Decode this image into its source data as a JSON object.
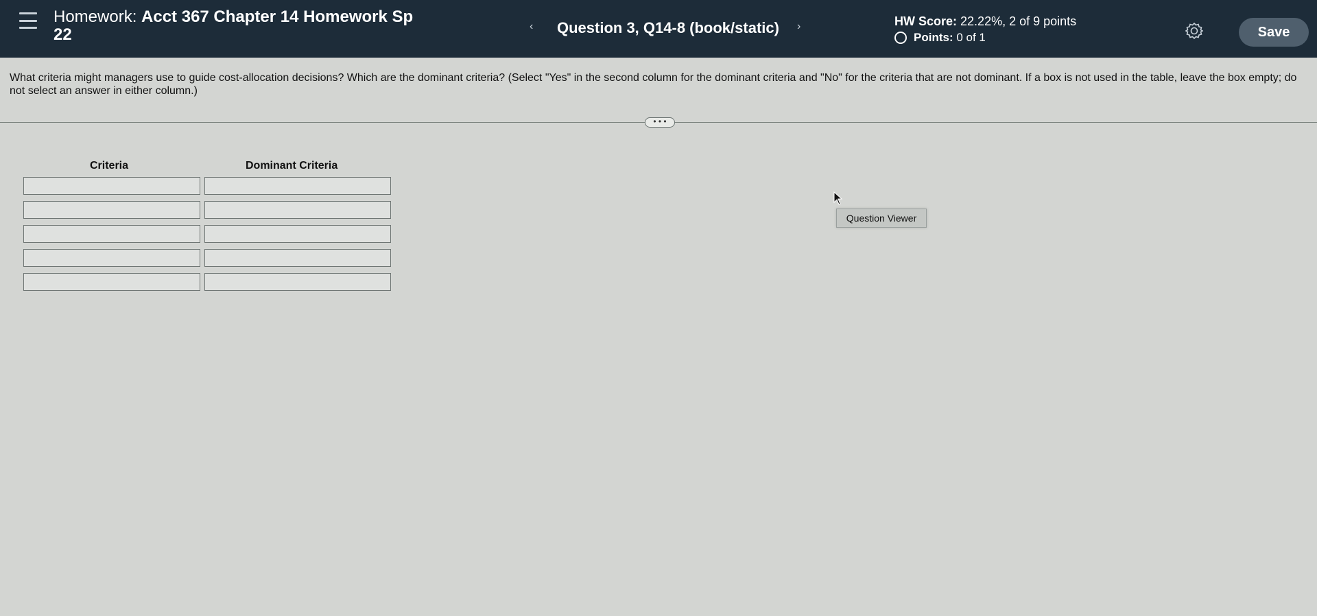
{
  "header": {
    "hw_label": "Homework:",
    "hw_name": "Acct 367 Chapter 14 Homework Sp",
    "hw_name_line2": "22",
    "question_title": "Question 3, Q14-8 (book/static)",
    "prev_icon": "chevron-left-icon",
    "next_icon": "chevron-right-icon",
    "score_label": "HW Score:",
    "score_value": "22.22%, 2 of 9 points",
    "points_label": "Points:",
    "points_value": "0 of 1",
    "save_label": "Save"
  },
  "question": {
    "text": "What criteria might managers use to guide cost-allocation decisions? Which are the dominant criteria? (Select \"Yes\" in the second column for the dominant criteria and \"No\" for the criteria that are not dominant. If a box is not used in the table, leave the box empty; do not select an answer in either column.)",
    "more_label": "• • •"
  },
  "table": {
    "headers": [
      "Criteria",
      "Dominant Criteria"
    ],
    "rows": [
      [
        "",
        ""
      ],
      [
        "",
        ""
      ],
      [
        "",
        ""
      ],
      [
        "",
        ""
      ],
      [
        "",
        ""
      ]
    ]
  },
  "viewer": {
    "label": "Question Viewer"
  },
  "colors": {
    "header_bg": "#1d2c39",
    "page_bg": "#d3d5d2",
    "save_bg": "#4f5f6d"
  }
}
